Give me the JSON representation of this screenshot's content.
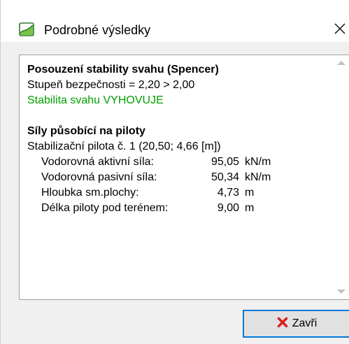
{
  "window": {
    "title": "Podrobné výsledky",
    "app_icon": "geo5-app-icon",
    "close_icon": "close-x-icon"
  },
  "results": {
    "stability": {
      "heading": "Posouzení stability svahu (Spencer)",
      "safety_factor_line": "Stupeň bezpečnosti = 2,20 > 2,00",
      "verdict": "Stabilita svahu VYHOVUJE",
      "verdict_color": "#00a000"
    },
    "piles": {
      "heading": "Síly působící na piloty",
      "pile_line": "Stabilizační pilota č. 1 (20,50; 4,66 [m])",
      "rows": [
        {
          "label": "Vodorovná aktivní síla:",
          "value": "95,05",
          "unit": "kN/m"
        },
        {
          "label": "Vodorovná pasivní síla:",
          "value": "50,34",
          "unit": "kN/m"
        },
        {
          "label": "Hloubka sm.plochy:",
          "value": "4,73",
          "unit": "m"
        },
        {
          "label": "Délka piloty pod terénem:",
          "value": "9,00",
          "unit": "m"
        }
      ]
    }
  },
  "scrollbar": {
    "up_icon": "scroll-up-arrow-icon",
    "down_icon": "scroll-down-arrow-icon"
  },
  "footer": {
    "close_button_label": "Zavři",
    "close_button_icon": "red-x-icon",
    "accent_color": "#0078d7"
  }
}
